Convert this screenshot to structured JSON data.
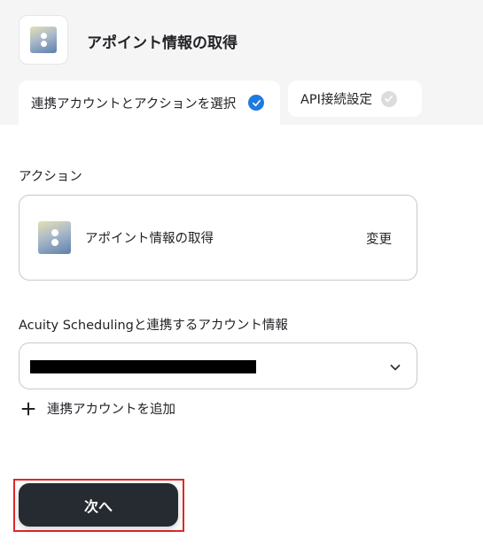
{
  "header": {
    "title": "アポイント情報の取得",
    "tabs": [
      {
        "label": "連携アカウントとアクションを選択",
        "state": "completed"
      },
      {
        "label": "API接続設定",
        "state": "pending"
      }
    ]
  },
  "action_section": {
    "label": "アクション",
    "action_name": "アポイント情報の取得",
    "change_label": "変更"
  },
  "account_section": {
    "label": "Acuity Schedulingと連携するアカウント情報",
    "selected_value": "",
    "add_account_label": "連携アカウントを追加"
  },
  "footer": {
    "next_label": "次へ"
  },
  "colors": {
    "check_active": "#1f7ae0",
    "check_inactive": "#dcdcdc",
    "next_button_bg": "#262a31",
    "highlight": "#e02828"
  },
  "icons": {
    "app_logo": "acuity-scheduling-logo",
    "tab_check": "check-circle-icon",
    "select": "chevron-down-icon",
    "add": "plus-icon"
  }
}
